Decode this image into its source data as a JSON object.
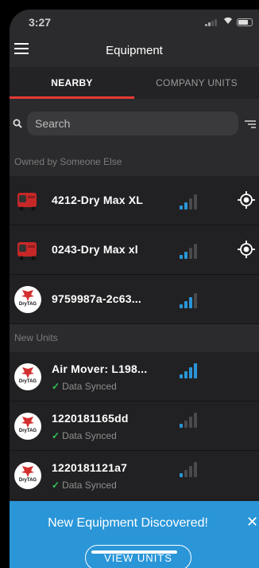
{
  "status_bar": {
    "time": "3:27"
  },
  "header": {
    "title": "Equipment",
    "menu_icon": "hamburger-menu-icon"
  },
  "tabs": [
    {
      "label": "NEARBY",
      "active": true
    },
    {
      "label": "COMPANY UNITS",
      "active": false
    }
  ],
  "accent_color": "#e53935",
  "search": {
    "placeholder": "Search",
    "icon": "search-icon",
    "filter_icon": "filter-icon"
  },
  "sections": [
    {
      "label": "Owned by Someone Else",
      "items": [
        {
          "name": "4212-Dry Max XL",
          "signal_bars": 2,
          "thumbnail": "equipment-photo",
          "has_locate": true
        },
        {
          "name": "0243-Dry Max xl",
          "signal_bars": 2,
          "thumbnail": "equipment-photo",
          "has_locate": true
        },
        {
          "name": "9759987a-2c63...",
          "signal_bars": 3,
          "thumbnail": "drytag-logo",
          "has_locate": false
        }
      ]
    },
    {
      "label": "New Units",
      "items": [
        {
          "name": "Air Mover: L198...",
          "status": "Data Synced",
          "signal_bars": 4,
          "thumbnail": "drytag-logo"
        },
        {
          "name": "1220181165dd",
          "status": "Data Synced",
          "signal_bars": 1,
          "thumbnail": "drytag-logo"
        },
        {
          "name": "1220181121a7",
          "status": "Data Synced",
          "signal_bars": 1,
          "thumbnail": "drytag-logo"
        }
      ]
    }
  ],
  "logo_text": "DryTAG",
  "banner": {
    "text": "New Equipment Discovered!",
    "button_label": "VIEW UNITS",
    "close_label": "✕",
    "color": "#2a96d8"
  },
  "signal_colors": {
    "active": "#2a96d8",
    "inactive": "#4a4a4c"
  }
}
